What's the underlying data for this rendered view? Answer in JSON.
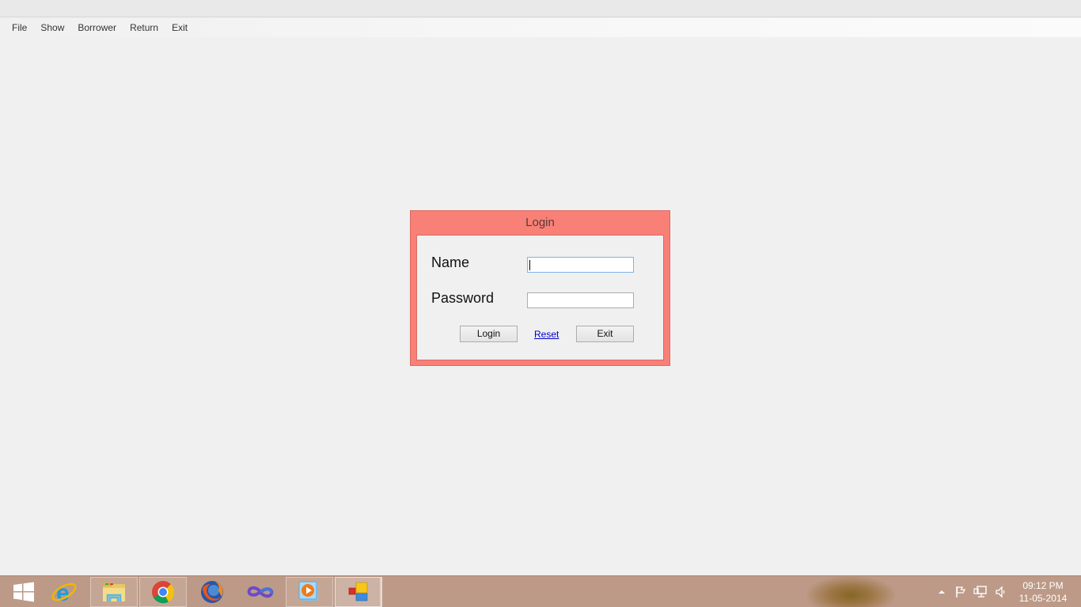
{
  "menu": {
    "items": [
      {
        "label": "File"
      },
      {
        "label": "Show"
      },
      {
        "label": "Borrower"
      },
      {
        "label": "Return"
      },
      {
        "label": "Exit"
      }
    ]
  },
  "login": {
    "title": "Login",
    "name_label": "Name",
    "password_label": "Password",
    "name_value": "",
    "password_value": "",
    "login_button": "Login",
    "reset_link": "Reset",
    "exit_button": "Exit",
    "accent_color": "#f88077"
  },
  "taskbar": {
    "apps": [
      {
        "name": "start",
        "icon": "windows-logo-icon"
      },
      {
        "name": "internet-explorer",
        "icon": "ie-icon"
      },
      {
        "name": "file-explorer",
        "icon": "folder-icon"
      },
      {
        "name": "chrome",
        "icon": "chrome-icon"
      },
      {
        "name": "firefox",
        "icon": "firefox-icon"
      },
      {
        "name": "visual-studio",
        "icon": "infinity-icon"
      },
      {
        "name": "media-player",
        "icon": "play-icon"
      },
      {
        "name": "library-app",
        "icon": "app-squares-icon"
      }
    ],
    "tray": {
      "time": "09:12 PM",
      "date": "11-05-2014"
    }
  }
}
